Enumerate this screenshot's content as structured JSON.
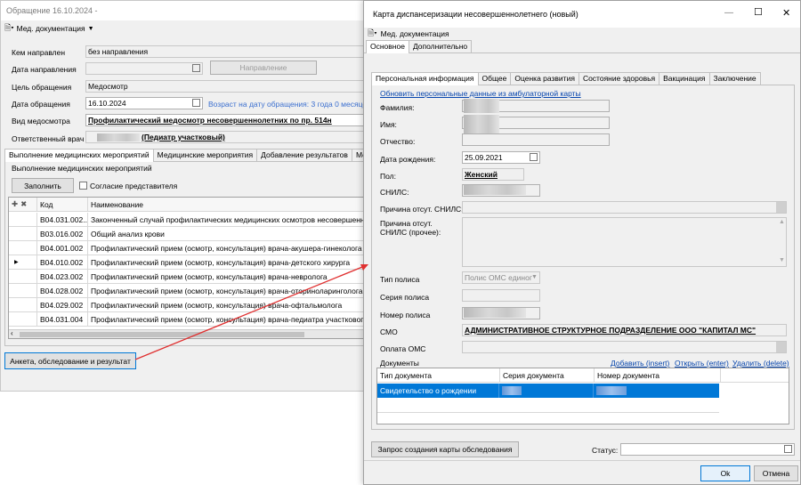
{
  "left_window": {
    "title": "Обращение 16.10.2024 -",
    "menu_label": "Мед. документация",
    "fields": {
      "referred_by_label": "Кем направлен",
      "referred_by_value": "без направления",
      "referral_date_label": "Дата направления",
      "referral_button": "Направление",
      "purpose_label": "Цель обращения",
      "purpose_value": "Медосмотр",
      "visit_date_label": "Дата обращения",
      "visit_date_value": "16.10.2024",
      "age_text": "Возраст на дату обращения: 3 года 0 месяцев",
      "exam_type_label": "Вид медосмотра",
      "exam_type_value": "Профилактический медосмотр несовершеннолетних по пр. 514н",
      "doctor_label": "Ответственный врач",
      "doctor_value": "(Педиатр участковый)"
    },
    "tabs": [
      "Выполнение медицинских мероприятий",
      "Медицинские мероприятия",
      "Добавление результатов",
      "Медицин"
    ],
    "group_title": "Выполнение медицинских мероприятий",
    "fill_button": "Заполнить",
    "consent_label": "Согласие представителя",
    "table": {
      "headers": [
        "Код",
        "Наименование"
      ],
      "rows": [
        {
          "code": "B04.031.002...",
          "name": "Законченный случай профилактических медицинских осмотров несовершеннолет"
        },
        {
          "code": "B03.016.002",
          "name": "Общий анализ крови"
        },
        {
          "code": "B04.001.002",
          "name": "Профилактический прием (осмотр, консультация) врача-акушера-гинеколога"
        },
        {
          "code": "B04.010.002",
          "name": "Профилактический прием (осмотр, консультация) врача-детского хирурга"
        },
        {
          "code": "B04.023.002",
          "name": "Профилактический прием (осмотр, консультация) врача-невролога"
        },
        {
          "code": "B04.028.002",
          "name": "Профилактический прием (осмотр, консультация) врача-оториноларинголога"
        },
        {
          "code": "B04.029.002",
          "name": "Профилактический прием (осмотр, консультация) врача-офтальмолога"
        },
        {
          "code": "B04.031.004",
          "name": "Профилактический прием (осмотр, консультация) врача-педиатра участкового"
        }
      ]
    },
    "questionnaire_button": "Анкета, обследование и результат"
  },
  "right_window": {
    "title": "Карта диспансеризации несовершеннолетнего (новый)",
    "menu_label": "Мед. документация",
    "top_tabs": [
      "Основное",
      "Дополнительно"
    ],
    "tabs": [
      "Персональная информация",
      "Общее",
      "Оценка развития",
      "Состояние здоровья",
      "Вакцинация",
      "Заключение"
    ],
    "refresh_link": "Обновить персональные данные из амбулаторной карты",
    "labels": {
      "surname": "Фамилия:",
      "name": "Имя:",
      "patronymic": "Отчество:",
      "birthdate": "Дата рождения:",
      "sex": "Пол:",
      "snils": "СНИЛС:",
      "snils_reason": "Причина отсут. СНИЛС:",
      "snils_reason_other": "Причина отсут. СНИЛС (прочее):",
      "policy_type": "Тип полиса",
      "policy_series": "Серия полиса",
      "policy_number": "Номер полиса",
      "smo": "СМО",
      "oms_payment": "Оплата ОМС",
      "documents": "Документы"
    },
    "values": {
      "birthdate": "25.09.2021",
      "sex": "Женский",
      "policy_type": "Полис ОМС единог",
      "smo": "АДМИНИСТРАТИВНОЕ СТРУКТУРНОЕ ПОДРАЗДЕЛЕНИЕ ООО \"КАПИТАЛ МС\""
    },
    "doc_links": {
      "add": "Добавить (insert)",
      "open": "Открыть (enter)",
      "delete": "Удалить (delete)"
    },
    "doc_table": {
      "headers": [
        "Тип документа",
        "Серия документа",
        "Номер документа"
      ],
      "rows": [
        {
          "type": "Свидетельство о рождении"
        }
      ]
    },
    "exam_request_button": "Запрос создания карты обследования",
    "status_label": "Статус:",
    "ok_button": "Ok",
    "cancel_button": "Отмена",
    "minimize": "—",
    "maximize": "☐",
    "close": "✕"
  },
  "colors": {
    "link": "#0645ad",
    "selection": "#0078d7",
    "arrow": "#e03030"
  }
}
